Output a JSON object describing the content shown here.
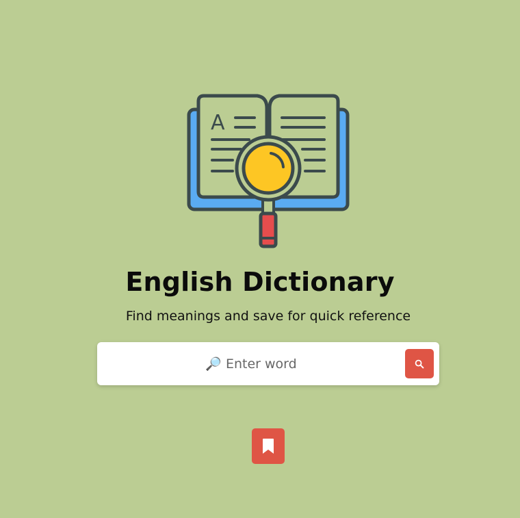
{
  "header": {
    "title": "English Dictionary",
    "subtitle": "Find meanings and save for quick reference"
  },
  "search": {
    "placeholder": "🔎 Enter word",
    "value": "",
    "button_icon": "search-icon"
  },
  "bookmarks": {
    "button_icon": "bookmark-icon"
  },
  "logo": {
    "icon": "dictionary-book-magnifier-icon",
    "letter": "A"
  },
  "colors": {
    "background": "#bbcd93",
    "accent": "#df5545",
    "book_cover": "#5aabf2",
    "lens": "#fdc624",
    "outline": "#3b4a4c"
  }
}
